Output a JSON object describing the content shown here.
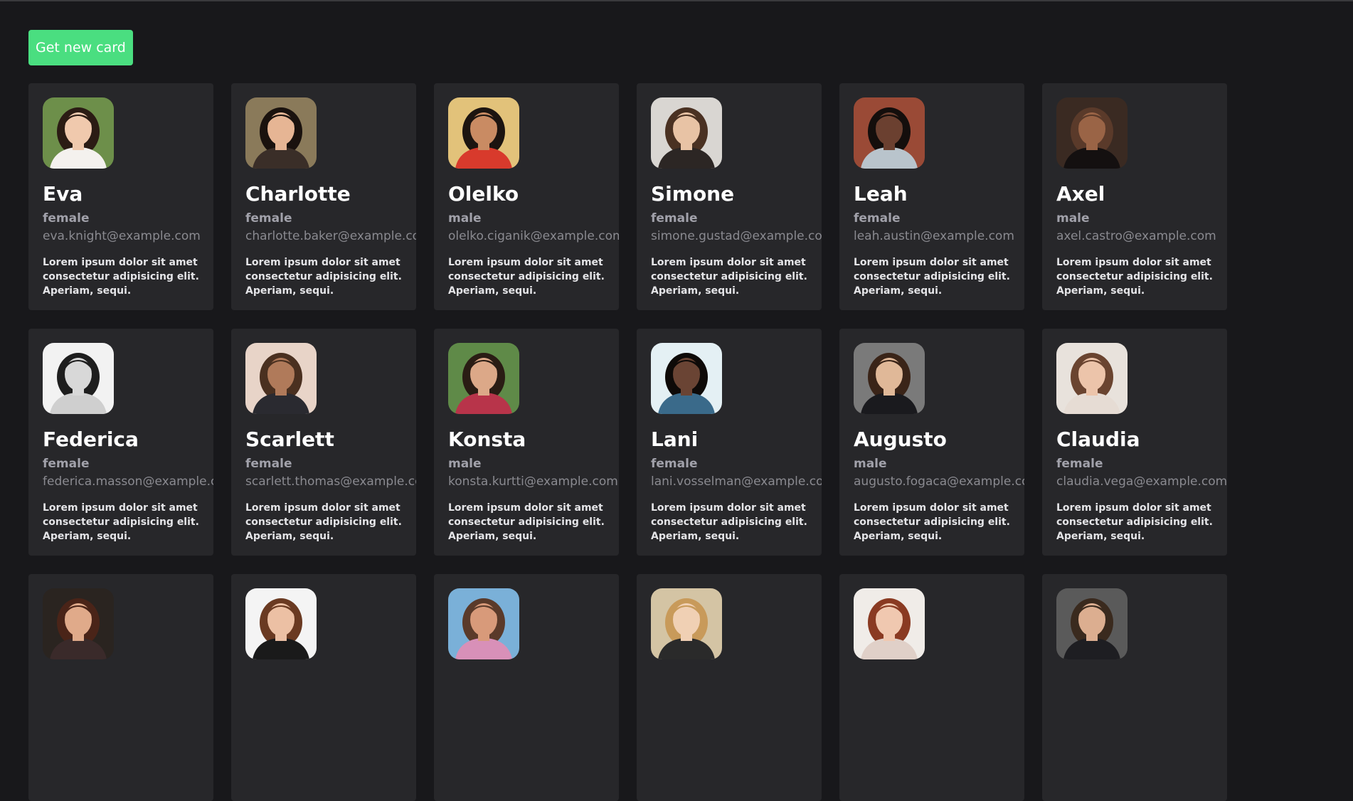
{
  "button": {
    "label": "Get new card"
  },
  "cards": [
    {
      "name": "Eva",
      "gender": "female",
      "email": "eva.knight@example.com",
      "description": "Lorem ipsum dolor sit amet consectetur adipisicing elit. Aperiam, sequi.",
      "avatar": {
        "bg": "#6d8f4a",
        "skin": "#f0c9ad",
        "hair": "#2b1c14",
        "shirt": "#f4f1ee"
      }
    },
    {
      "name": "Charlotte",
      "gender": "female",
      "email": "charlotte.baker@example.com",
      "description": "Lorem ipsum dolor sit amet consectetur adipisicing elit. Aperiam, sequi.",
      "avatar": {
        "bg": "#8a7a5a",
        "skin": "#e6b594",
        "hair": "#1a120e",
        "shirt": "#3a2e28"
      }
    },
    {
      "name": "Olelko",
      "gender": "male",
      "email": "olelko.ciganik@example.com",
      "description": "Lorem ipsum dolor sit amet consectetur adipisicing elit. Aperiam, sequi.",
      "avatar": {
        "bg": "#e2c27a",
        "skin": "#c98b63",
        "hair": "#1c1410",
        "shirt": "#d83a2c"
      }
    },
    {
      "name": "Simone",
      "gender": "female",
      "email": "simone.gustad@example.com",
      "description": "Lorem ipsum dolor sit amet consectetur adipisicing elit. Aperiam, sequi.",
      "avatar": {
        "bg": "#d9d6d2",
        "skin": "#e8c3a5",
        "hair": "#4a3122",
        "shirt": "#2c2624"
      }
    },
    {
      "name": "Leah",
      "gender": "female",
      "email": "leah.austin@example.com",
      "description": "Lorem ipsum dolor sit amet consectetur adipisicing elit. Aperiam, sequi.",
      "avatar": {
        "bg": "#9a4a36",
        "skin": "#6b4030",
        "hair": "#140e0c",
        "shirt": "#b9c4cc"
      }
    },
    {
      "name": "Axel",
      "gender": "male",
      "email": "axel.castro@example.com",
      "description": "Lorem ipsum dolor sit amet consectetur adipisicing elit. Aperiam, sequi.",
      "avatar": {
        "bg": "#3a2a22",
        "skin": "#9a6446",
        "hair": "#5a3a2a",
        "shirt": "#141010"
      }
    },
    {
      "name": "Federica",
      "gender": "female",
      "email": "federica.masson@example.com",
      "description": "Lorem ipsum dolor sit amet consectetur adipisicing elit. Aperiam, sequi.",
      "avatar": {
        "bg": "#f2f2f2",
        "skin": "#d8d8d8",
        "hair": "#1e1e1e",
        "shirt": "#cfcfcf"
      }
    },
    {
      "name": "Scarlett",
      "gender": "female",
      "email": "scarlett.thomas@example.com",
      "description": "Lorem ipsum dolor sit amet consectetur adipisicing elit. Aperiam, sequi.",
      "avatar": {
        "bg": "#e8d4c8",
        "skin": "#b07a5a",
        "hair": "#4a3020",
        "shirt": "#2a2a30"
      }
    },
    {
      "name": "Konsta",
      "gender": "male",
      "email": "konsta.kurtti@example.com",
      "description": "Lorem ipsum dolor sit amet consectetur adipisicing elit. Aperiam, sequi.",
      "avatar": {
        "bg": "#5f8a48",
        "skin": "#dca888",
        "hair": "#2a1c14",
        "shirt": "#b8344a"
      }
    },
    {
      "name": "Lani",
      "gender": "female",
      "email": "lani.vosselman@example.com",
      "description": "Lorem ipsum dolor sit amet consectetur adipisicing elit. Aperiam, sequi.",
      "avatar": {
        "bg": "#e4f0f4",
        "skin": "#6a4434",
        "hair": "#0e0a08",
        "shirt": "#3a6a8a"
      }
    },
    {
      "name": "Augusto",
      "gender": "male",
      "email": "augusto.fogaca@example.com",
      "description": "Lorem ipsum dolor sit amet consectetur adipisicing elit. Aperiam, sequi.",
      "avatar": {
        "bg": "#7a7a7a",
        "skin": "#e0b898",
        "hair": "#3a2418",
        "shirt": "#1a1a1e"
      }
    },
    {
      "name": "Claudia",
      "gender": "female",
      "email": "claudia.vega@example.com",
      "description": "Lorem ipsum dolor sit amet consectetur adipisicing elit. Aperiam, sequi.",
      "avatar": {
        "bg": "#e8e2dc",
        "skin": "#ecc4aa",
        "hair": "#6a4430",
        "shirt": "#e6dcd4"
      }
    },
    {
      "name": "",
      "gender": "",
      "email": "",
      "description": "",
      "avatar": {
        "bg": "#2a2420",
        "skin": "#e0aa8a",
        "hair": "#4a2418",
        "shirt": "#3a2a2a"
      }
    },
    {
      "name": "",
      "gender": "",
      "email": "",
      "description": "",
      "avatar": {
        "bg": "#f4f4f4",
        "skin": "#ecc0a4",
        "hair": "#6a3a22",
        "shirt": "#1a1a1a"
      }
    },
    {
      "name": "",
      "gender": "",
      "email": "",
      "description": "",
      "avatar": {
        "bg": "#7ab0d8",
        "skin": "#d89a7a",
        "hair": "#5a3a2a",
        "shirt": "#d890b8"
      }
    },
    {
      "name": "",
      "gender": "",
      "email": "",
      "description": "",
      "avatar": {
        "bg": "#d4c4a4",
        "skin": "#f0d0b4",
        "hair": "#c89a5a",
        "shirt": "#2a2a2a"
      }
    },
    {
      "name": "",
      "gender": "",
      "email": "",
      "description": "",
      "avatar": {
        "bg": "#f0ece8",
        "skin": "#f0c8b0",
        "hair": "#8a3a22",
        "shirt": "#e0d0c8"
      }
    },
    {
      "name": "",
      "gender": "",
      "email": "",
      "description": "",
      "avatar": {
        "bg": "#5a5a5a",
        "skin": "#dcae90",
        "hair": "#3a2a1e",
        "shirt": "#1e1e22"
      }
    }
  ]
}
